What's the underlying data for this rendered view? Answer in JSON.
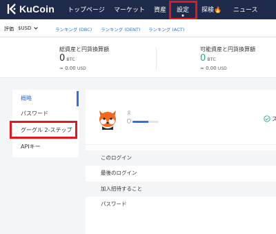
{
  "brand": {
    "name": "KuCoin"
  },
  "nav": {
    "items": [
      {
        "label": "トップページ"
      },
      {
        "label": "マーケット"
      },
      {
        "label": "資産"
      },
      {
        "label": "設定"
      },
      {
        "label": "探検🔥"
      },
      {
        "label": "ニュース"
      }
    ],
    "active_index": 3
  },
  "subbar": {
    "valuation_label": "評価",
    "currency": "$USD",
    "links": [
      {
        "label": "ランキング (DBC)"
      },
      {
        "label": "ランキング (DENT)"
      },
      {
        "label": "ランキング (ACT)"
      }
    ]
  },
  "balance": {
    "total": {
      "title": "総資産と円貨換算額",
      "value": "0",
      "unit": "BTC",
      "fiat": "≈ 0.00",
      "fiat_unit": "USD"
    },
    "available": {
      "title": "可能資産と円貨換算額",
      "value": "0",
      "unit": "BTC",
      "fiat": "≈ 0.00",
      "fiat_unit": "USD"
    }
  },
  "sidebar": {
    "items": [
      {
        "label": "概略"
      },
      {
        "label": "パスワード"
      },
      {
        "label": "グーグル 2-ステップ"
      },
      {
        "label": "APIキー"
      }
    ],
    "active_index": 0
  },
  "profile": {
    "security_level": 0.6,
    "status_label": "ス"
  },
  "info_rows": [
    {
      "label": "このログイン"
    },
    {
      "label": "最後のログイン"
    },
    {
      "label": "加入招待すること"
    },
    {
      "label": "パスワード"
    }
  ],
  "colors": {
    "nav_bg": "#1e2a4a",
    "accent": "#2f6fd6",
    "positive": "#1fb17f",
    "highlight": "#e8141e"
  }
}
